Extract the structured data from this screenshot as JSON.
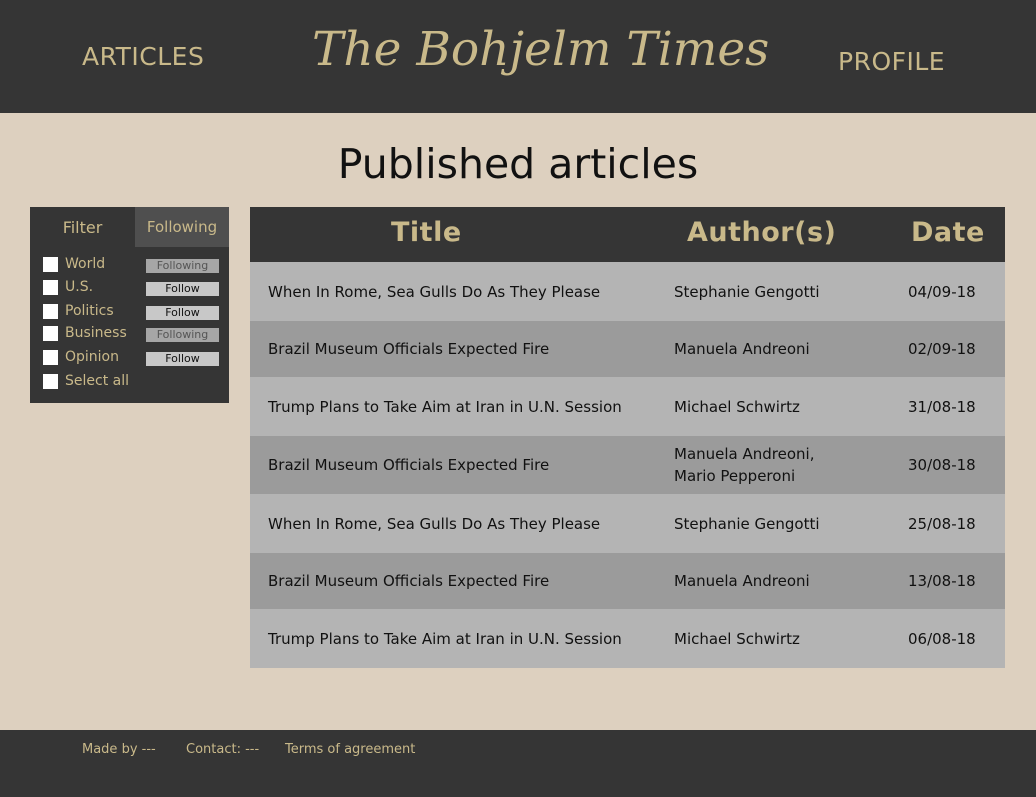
{
  "header": {
    "nav_articles": "ARTICLES",
    "brand": "The Bohjelm Times",
    "nav_profile": "PROFILE"
  },
  "page_title": "Published articles",
  "filter": {
    "filter_tab": "Filter",
    "following_tab": "Following",
    "categories": [
      {
        "label": "World",
        "button": "Following",
        "state": "following"
      },
      {
        "label": "U.S.",
        "button": "Follow",
        "state": "not-following"
      },
      {
        "label": "Politics",
        "button": "Follow",
        "state": "not-following"
      },
      {
        "label": "Business",
        "button": "Following",
        "state": "following"
      },
      {
        "label": "Opinion",
        "button": "Follow",
        "state": "not-following"
      }
    ],
    "select_all": "Select all"
  },
  "table": {
    "headers": {
      "title": "Title",
      "author": "Author(s)",
      "date": "Date"
    },
    "rows": [
      {
        "title": "When In Rome, Sea Gulls Do As They Please",
        "author": "Stephanie Gengotti",
        "date": "04/09-18"
      },
      {
        "title": "Brazil Museum Officials Expected Fire",
        "author": "Manuela Andreoni",
        "date": "02/09-18"
      },
      {
        "title": "Trump Plans to Take Aim at Iran in U.N. Session",
        "author": "Michael Schwirtz",
        "date": "31/08-18"
      },
      {
        "title": "Brazil Museum Officials Expected Fire",
        "author": "Manuela Andreoni,\nMario Pepperoni",
        "date": "30/08-18"
      },
      {
        "title": "When In Rome, Sea Gulls Do As They Please",
        "author": "Stephanie Gengotti",
        "date": "25/08-18"
      },
      {
        "title": "Brazil Museum Officials Expected Fire",
        "author": "Manuela Andreoni",
        "date": "13/08-18"
      },
      {
        "title": "Trump Plans to Take Aim at Iran in U.N. Session",
        "author": "Michael Schwirtz",
        "date": "06/08-18"
      }
    ]
  },
  "footer": {
    "made_by": "Made by ---",
    "contact": "Contact: ---",
    "terms": "Terms of agreement"
  },
  "colors": {
    "background": "#ddd0bf",
    "bar": "#353535",
    "accent": "#c9b98a",
    "row_light": "#b4b4b4",
    "row_dark": "#9b9b9b"
  }
}
